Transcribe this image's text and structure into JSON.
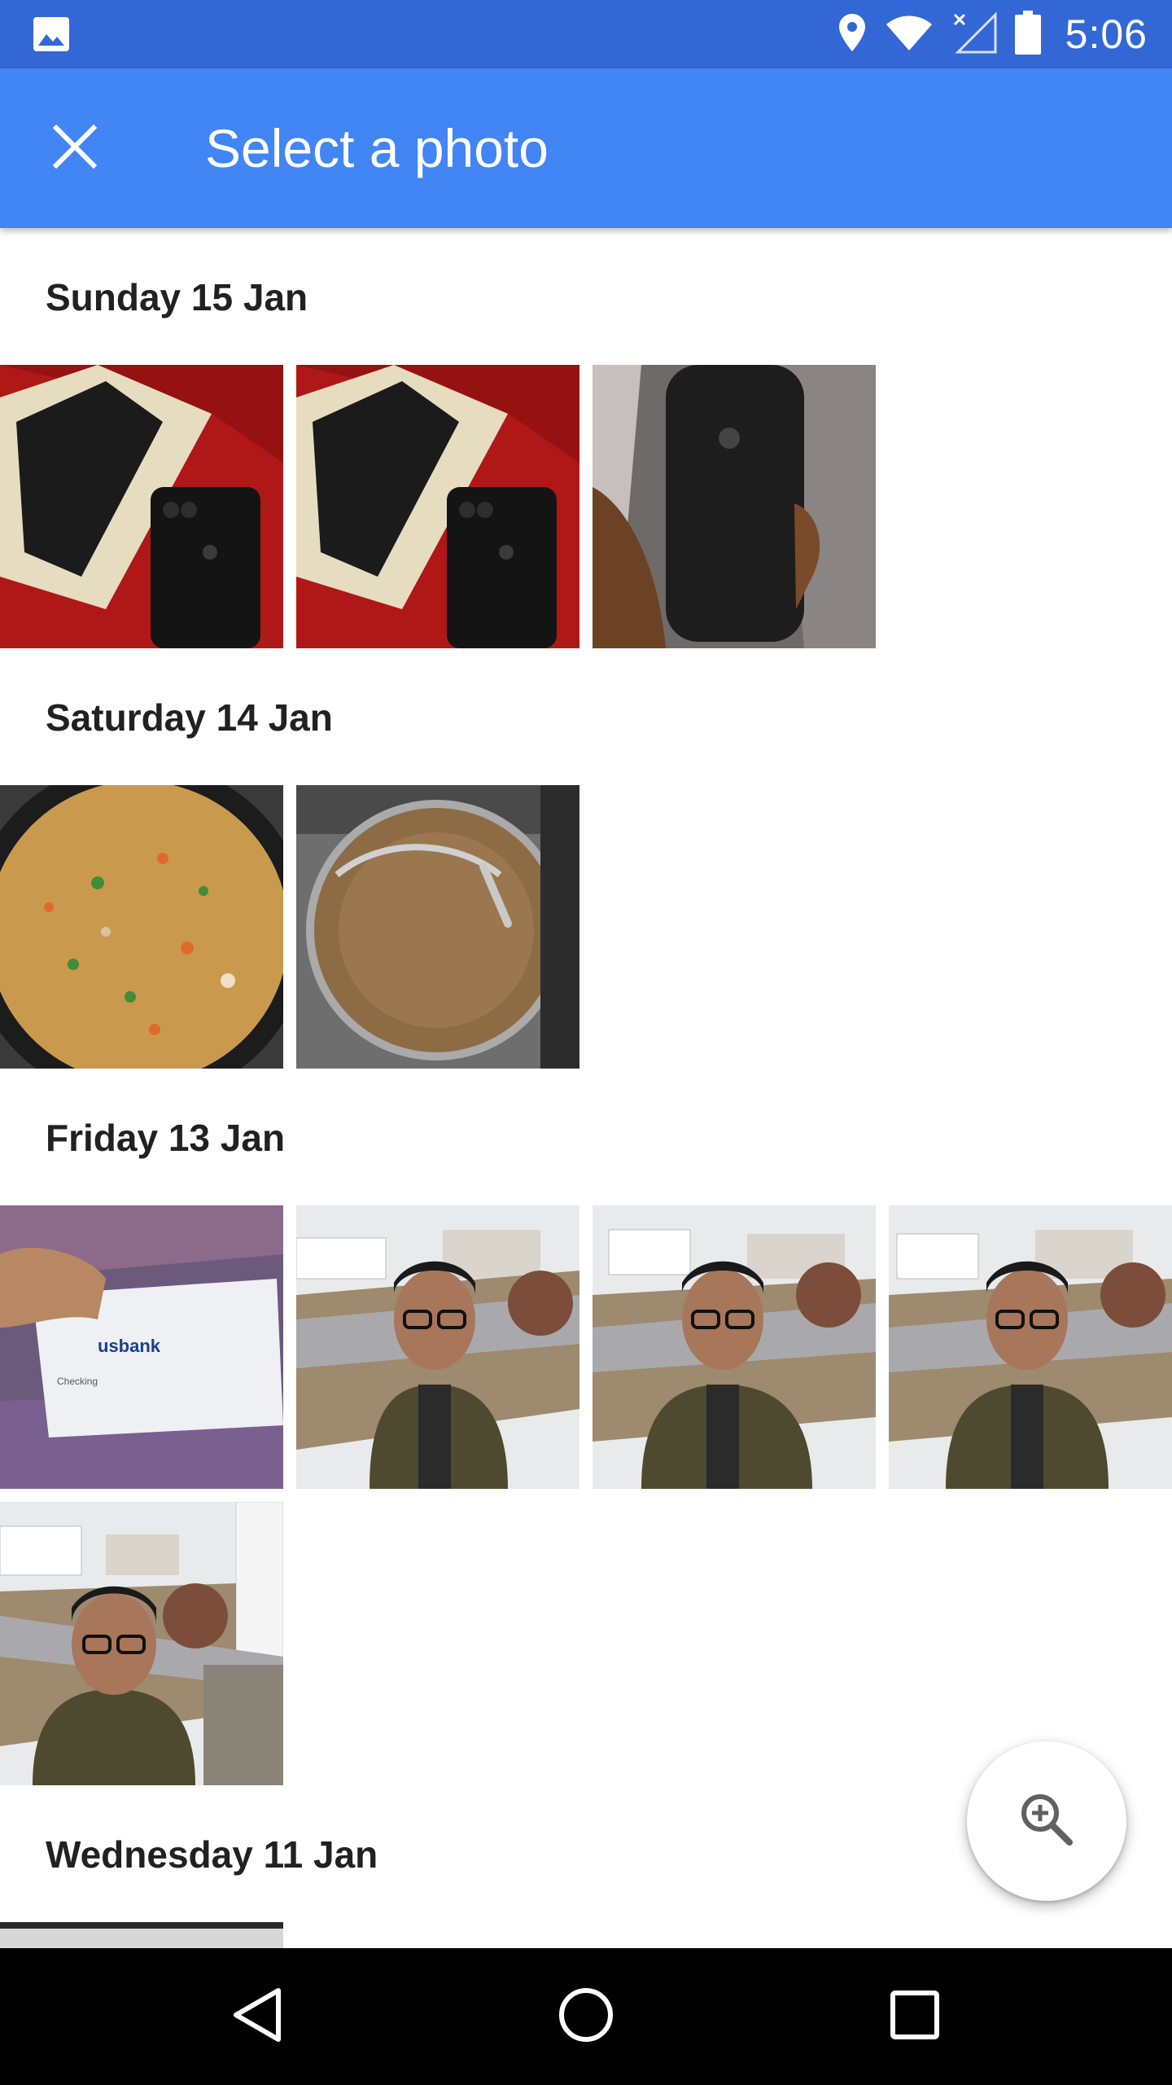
{
  "status_bar": {
    "time": "5:06",
    "icons": [
      "image-notification-icon",
      "location-icon",
      "wifi-icon",
      "no-signal-icon",
      "battery-icon"
    ]
  },
  "app_bar": {
    "title": "Select a photo",
    "close_icon": "close-icon"
  },
  "sections": [
    {
      "date": "Sunday 15 Jan",
      "photos": [
        "iphone-box-on-red",
        "iphone-box-on-red",
        "iphone-in-hand"
      ]
    },
    {
      "date": "Saturday 14 Jan",
      "photos": [
        "fried-rice-pan",
        "covered-pan"
      ]
    },
    {
      "date": "Friday 13 Jan",
      "photos": [
        "bank-card",
        "selfie-street",
        "selfie-street",
        "selfie-street",
        "selfie-street"
      ]
    },
    {
      "date": "Wednesday 11 Jan",
      "photos": [
        "partial-photo"
      ]
    }
  ],
  "bank_card": {
    "brand": "usbank",
    "account_type": "Checking"
  },
  "fab": {
    "icon": "zoom-in-icon"
  },
  "nav_bar": {
    "icons": [
      "back-icon",
      "home-icon",
      "recents-icon"
    ]
  },
  "colors": {
    "status_bar": "#3367d6",
    "app_bar": "#4285f4",
    "nav_bar": "#000000",
    "section_text": "#212121"
  }
}
